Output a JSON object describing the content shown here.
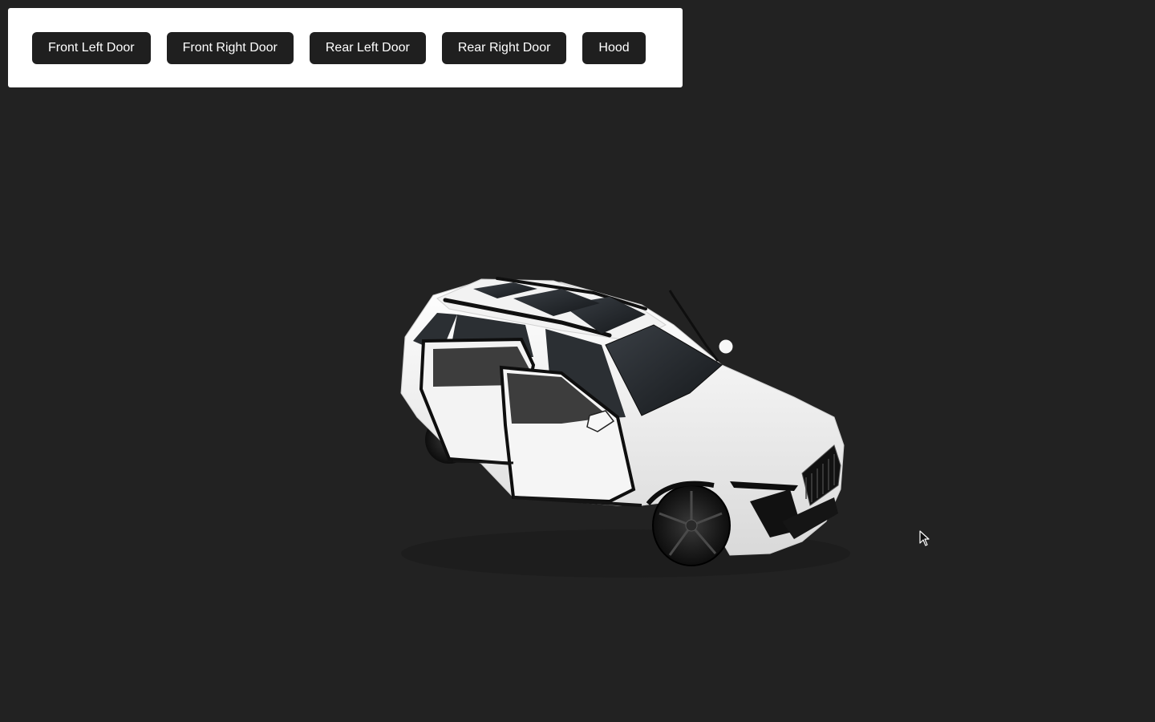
{
  "toolbar": {
    "buttons": [
      {
        "label": "Front Left Door"
      },
      {
        "label": "Front Right Door"
      },
      {
        "label": "Rear Left Door"
      },
      {
        "label": "Rear Right Door"
      },
      {
        "label": "Hood"
      }
    ]
  },
  "scene": {
    "background_color": "#222222",
    "model": "suv-car",
    "model_color": "#f4f4f4",
    "open_parts": [
      "Front Left Door",
      "Rear Left Door",
      "Hood"
    ]
  },
  "cursor": {
    "icon": "mouse-pointer-icon"
  }
}
